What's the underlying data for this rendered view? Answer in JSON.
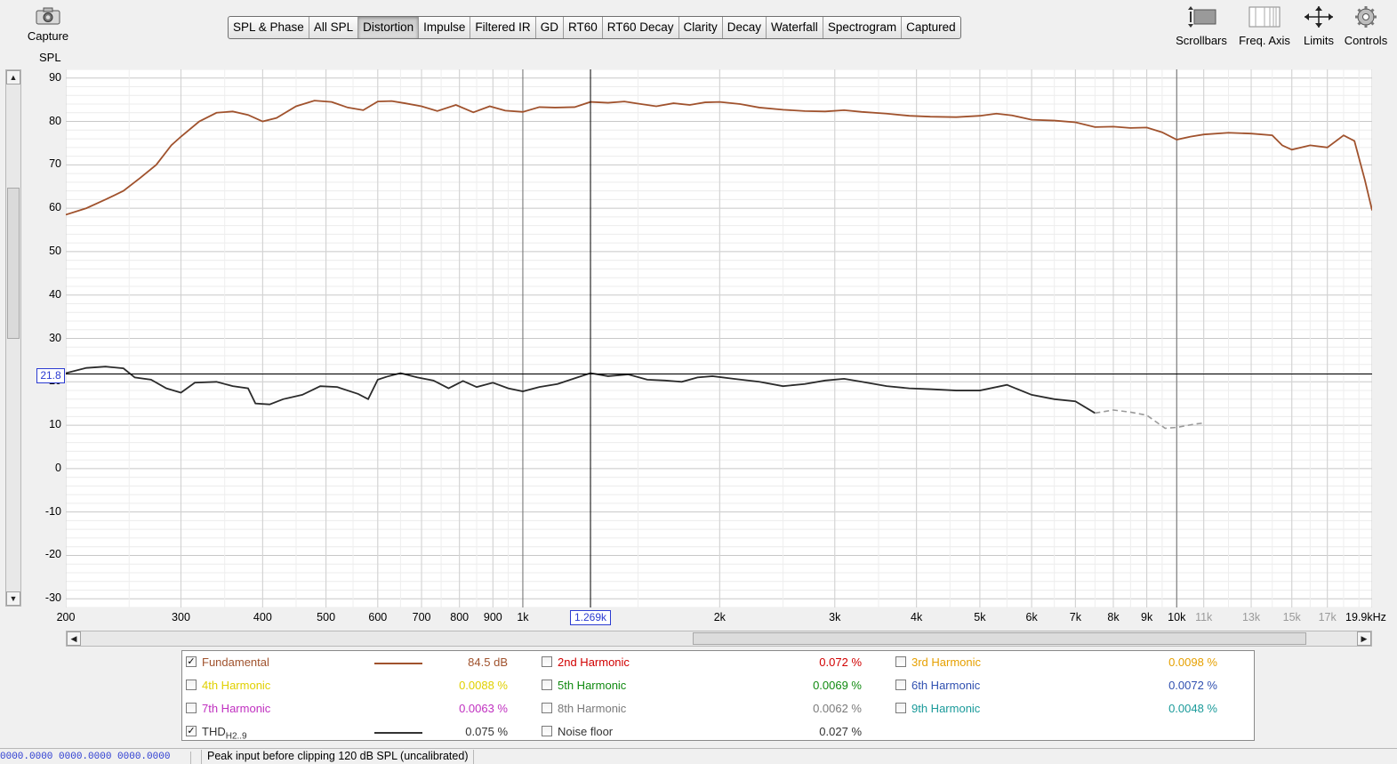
{
  "toolbar": {
    "capture_label": "Capture",
    "tabs": [
      {
        "label": "SPL & Phase",
        "active": false
      },
      {
        "label": "All SPL",
        "active": false
      },
      {
        "label": "Distortion",
        "active": true
      },
      {
        "label": "Impulse",
        "active": false
      },
      {
        "label": "Filtered IR",
        "active": false
      },
      {
        "label": "GD",
        "active": false
      },
      {
        "label": "RT60",
        "active": false
      },
      {
        "label": "RT60 Decay",
        "active": false
      },
      {
        "label": "Clarity",
        "active": false
      },
      {
        "label": "Decay",
        "active": false
      },
      {
        "label": "Waterfall",
        "active": false
      },
      {
        "label": "Spectrogram",
        "active": false
      },
      {
        "label": "Captured",
        "active": false
      }
    ],
    "right_tools": [
      {
        "label": "Scrollbars",
        "icon": "scrollbars-icon"
      },
      {
        "label": "Freq. Axis",
        "icon": "freq-axis-icon"
      },
      {
        "label": "Limits",
        "icon": "limits-icon"
      },
      {
        "label": "Controls",
        "icon": "gear-icon"
      }
    ]
  },
  "chart_data": {
    "type": "line",
    "ylabel": "SPL",
    "ylim": [
      -32,
      92
    ],
    "yticks": [
      "90",
      "80",
      "70",
      "60",
      "50",
      "40",
      "30",
      "20",
      "10",
      "0",
      "-10",
      "-20",
      "-30"
    ],
    "xscale": "log",
    "xlim": [
      200,
      19900
    ],
    "xticks": [
      {
        "f": 200,
        "label": "200",
        "dim": false
      },
      {
        "f": 300,
        "label": "300",
        "dim": false
      },
      {
        "f": 400,
        "label": "400",
        "dim": false
      },
      {
        "f": 500,
        "label": "500",
        "dim": false
      },
      {
        "f": 600,
        "label": "600",
        "dim": false
      },
      {
        "f": 700,
        "label": "700",
        "dim": false
      },
      {
        "f": 800,
        "label": "800",
        "dim": false
      },
      {
        "f": 900,
        "label": "900",
        "dim": false
      },
      {
        "f": 1000,
        "label": "1k",
        "dim": false
      },
      {
        "f": 2000,
        "label": "2k",
        "dim": false
      },
      {
        "f": 3000,
        "label": "3k",
        "dim": false
      },
      {
        "f": 4000,
        "label": "4k",
        "dim": false
      },
      {
        "f": 5000,
        "label": "5k",
        "dim": false
      },
      {
        "f": 6000,
        "label": "6k",
        "dim": false
      },
      {
        "f": 7000,
        "label": "7k",
        "dim": false
      },
      {
        "f": 8000,
        "label": "8k",
        "dim": false
      },
      {
        "f": 9000,
        "label": "9k",
        "dim": false
      },
      {
        "f": 10000,
        "label": "10k",
        "dim": false
      },
      {
        "f": 11000,
        "label": "11k",
        "dim": true
      },
      {
        "f": 13000,
        "label": "13k",
        "dim": true
      },
      {
        "f": 15000,
        "label": "15k",
        "dim": true
      },
      {
        "f": 17000,
        "label": "17k",
        "dim": true
      },
      {
        "f": 19900,
        "label": "19.9kHz",
        "dim": false
      }
    ],
    "cursor": {
      "x_label": "1.269k",
      "y_label": "21.8",
      "f": 1269,
      "y": 21.8
    },
    "series": [
      {
        "name": "Fundamental",
        "color": "#a0522d",
        "points": [
          [
            200,
            58.5
          ],
          [
            215,
            60
          ],
          [
            230,
            62
          ],
          [
            245,
            64
          ],
          [
            260,
            67
          ],
          [
            275,
            70
          ],
          [
            290,
            74.5
          ],
          [
            300,
            76.5
          ],
          [
            320,
            80
          ],
          [
            340,
            82
          ],
          [
            360,
            82.3
          ],
          [
            380,
            81.5
          ],
          [
            400,
            80
          ],
          [
            420,
            80.8
          ],
          [
            450,
            83.5
          ],
          [
            480,
            84.8
          ],
          [
            510,
            84.5
          ],
          [
            540,
            83.2
          ],
          [
            570,
            82.6
          ],
          [
            600,
            84.6
          ],
          [
            630,
            84.7
          ],
          [
            660,
            84.2
          ],
          [
            700,
            83.5
          ],
          [
            740,
            82.4
          ],
          [
            790,
            83.8
          ],
          [
            840,
            82.1
          ],
          [
            890,
            83.5
          ],
          [
            940,
            82.5
          ],
          [
            1000,
            82.2
          ],
          [
            1060,
            83.3
          ],
          [
            1120,
            83.2
          ],
          [
            1200,
            83.3
          ],
          [
            1269,
            84.5
          ],
          [
            1350,
            84.3
          ],
          [
            1430,
            84.6
          ],
          [
            1500,
            84.1
          ],
          [
            1600,
            83.5
          ],
          [
            1700,
            84.2
          ],
          [
            1800,
            83.8
          ],
          [
            1900,
            84.4
          ],
          [
            2000,
            84.5
          ],
          [
            2150,
            84.0
          ],
          [
            2300,
            83.2
          ],
          [
            2500,
            82.7
          ],
          [
            2700,
            82.4
          ],
          [
            2900,
            82.3
          ],
          [
            3100,
            82.6
          ],
          [
            3300,
            82.2
          ],
          [
            3600,
            81.8
          ],
          [
            3900,
            81.3
          ],
          [
            4200,
            81.1
          ],
          [
            4600,
            81.0
          ],
          [
            5000,
            81.3
          ],
          [
            5300,
            81.8
          ],
          [
            5600,
            81.4
          ],
          [
            6000,
            80.4
          ],
          [
            6500,
            80.2
          ],
          [
            7000,
            79.8
          ],
          [
            7500,
            78.7
          ],
          [
            8000,
            78.8
          ],
          [
            8500,
            78.5
          ],
          [
            9000,
            78.6
          ],
          [
            9500,
            77.5
          ],
          [
            10000,
            75.8
          ],
          [
            10500,
            76.5
          ],
          [
            11000,
            77.0
          ],
          [
            12000,
            77.4
          ],
          [
            13000,
            77.2
          ],
          [
            14000,
            76.8
          ],
          [
            14500,
            74.5
          ],
          [
            15000,
            73.5
          ],
          [
            16000,
            74.5
          ],
          [
            17000,
            74.0
          ],
          [
            18000,
            76.8
          ],
          [
            18700,
            75.5
          ],
          [
            19400,
            66.5
          ],
          [
            19900,
            59.5
          ]
        ]
      },
      {
        "name": "THD",
        "color": "#2b2b2b",
        "points": [
          [
            200,
            22.0
          ],
          [
            215,
            23.2
          ],
          [
            230,
            23.5
          ],
          [
            245,
            23.1
          ],
          [
            255,
            21.0
          ],
          [
            270,
            20.5
          ],
          [
            285,
            18.5
          ],
          [
            300,
            17.5
          ],
          [
            315,
            19.8
          ],
          [
            340,
            20.0
          ],
          [
            360,
            19.0
          ],
          [
            380,
            18.5
          ],
          [
            390,
            15.0
          ],
          [
            410,
            14.8
          ],
          [
            430,
            16.0
          ],
          [
            460,
            17.0
          ],
          [
            490,
            19.0
          ],
          [
            520,
            18.8
          ],
          [
            560,
            17.2
          ],
          [
            580,
            16.0
          ],
          [
            600,
            20.5
          ],
          [
            620,
            21.2
          ],
          [
            650,
            22.0
          ],
          [
            690,
            21.0
          ],
          [
            730,
            20.3
          ],
          [
            770,
            18.5
          ],
          [
            810,
            20.2
          ],
          [
            850,
            18.8
          ],
          [
            900,
            19.8
          ],
          [
            950,
            18.5
          ],
          [
            1000,
            17.8
          ],
          [
            1060,
            18.8
          ],
          [
            1130,
            19.5
          ],
          [
            1200,
            20.8
          ],
          [
            1269,
            22.0
          ],
          [
            1350,
            21.3
          ],
          [
            1450,
            21.7
          ],
          [
            1550,
            20.5
          ],
          [
            1650,
            20.3
          ],
          [
            1750,
            20.0
          ],
          [
            1850,
            21.0
          ],
          [
            1950,
            21.3
          ],
          [
            2100,
            20.7
          ],
          [
            2300,
            20.0
          ],
          [
            2500,
            19.0
          ],
          [
            2700,
            19.5
          ],
          [
            2900,
            20.3
          ],
          [
            3100,
            20.7
          ],
          [
            3300,
            20.0
          ],
          [
            3600,
            19.0
          ],
          [
            3900,
            18.5
          ],
          [
            4200,
            18.3
          ],
          [
            4600,
            18.0
          ],
          [
            5000,
            18.0
          ],
          [
            5500,
            19.3
          ],
          [
            6000,
            17.0
          ],
          [
            6500,
            16.0
          ],
          [
            7000,
            15.5
          ],
          [
            7500,
            12.8
          ],
          [
            8000,
            13.5
          ],
          [
            8500,
            13.0
          ],
          [
            9000,
            12.3
          ],
          [
            9600,
            9.3
          ],
          [
            10000,
            9.5
          ],
          [
            10700,
            10.3
          ],
          [
            11000,
            10.5
          ]
        ]
      }
    ]
  },
  "legend": {
    "rows": [
      [
        {
          "label": "Fundamental",
          "checked": true,
          "color": "#a0522d",
          "line": true,
          "value": "84.5 dB"
        },
        {
          "label": "2nd Harmonic",
          "checked": false,
          "color": "#d10000",
          "line": false,
          "value": "0.072 %"
        },
        {
          "label": "3rd Harmonic",
          "checked": false,
          "color": "#e6a000",
          "line": false,
          "value": "0.0098 %"
        }
      ],
      [
        {
          "label": "4th Harmonic",
          "checked": false,
          "color": "#e0d000",
          "line": false,
          "value": "0.0088 %"
        },
        {
          "label": "5th Harmonic",
          "checked": false,
          "color": "#108a10",
          "line": false,
          "value": "0.0069 %"
        },
        {
          "label": "6th Harmonic",
          "checked": false,
          "color": "#3050b0",
          "line": false,
          "value": "0.0072 %"
        }
      ],
      [
        {
          "label": "7th Harmonic",
          "checked": false,
          "color": "#c030c0",
          "line": false,
          "value": "0.0063 %"
        },
        {
          "label": "8th Harmonic",
          "checked": false,
          "color": "#7a7a7a",
          "line": false,
          "value": "0.0062 %"
        },
        {
          "label": "9th Harmonic",
          "checked": false,
          "color": "#1a9a9a",
          "line": false,
          "value": "0.0048 %"
        }
      ],
      [
        {
          "label": "THD",
          "sub": "H2..9",
          "checked": true,
          "color": "#333333",
          "line": true,
          "value": "0.075 %"
        },
        {
          "label": "Noise floor",
          "checked": false,
          "color": "#333333",
          "line": false,
          "value": "0.027 %"
        }
      ]
    ]
  },
  "status": {
    "left": "0000.0000   0000.0000   0000.0000",
    "right": "Peak input before clipping 120 dB SPL (uncalibrated)"
  }
}
